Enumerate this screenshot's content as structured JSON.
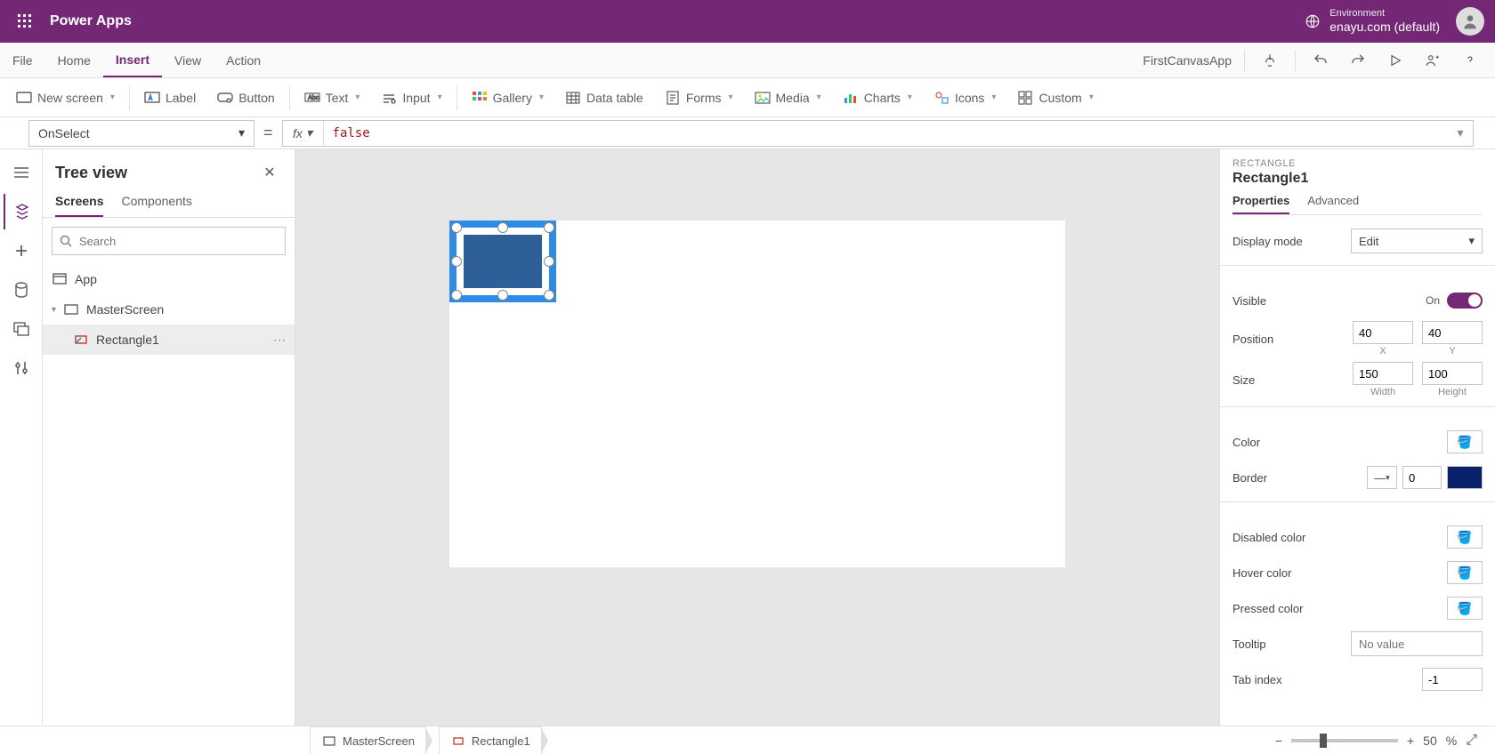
{
  "suite": {
    "app_name": "Power Apps",
    "env_label": "Environment",
    "env_name": "enayu.com (default)"
  },
  "menu": {
    "items": [
      "File",
      "Home",
      "Insert",
      "View",
      "Action"
    ],
    "active": "Insert",
    "app_title": "FirstCanvasApp"
  },
  "ribbon": {
    "new_screen": "New screen",
    "label": "Label",
    "button": "Button",
    "text": "Text",
    "input": "Input",
    "gallery": "Gallery",
    "data_table": "Data table",
    "forms": "Forms",
    "media": "Media",
    "charts": "Charts",
    "icons": "Icons",
    "custom": "Custom"
  },
  "formula": {
    "property": "OnSelect",
    "fx": "fx",
    "value": "false"
  },
  "tree": {
    "title": "Tree view",
    "tabs": {
      "screens": "Screens",
      "components": "Components"
    },
    "search_placeholder": "Search",
    "app": "App",
    "screen": "MasterScreen",
    "shape": "Rectangle1"
  },
  "props": {
    "category": "RECTANGLE",
    "name": "Rectangle1",
    "tabs": {
      "properties": "Properties",
      "advanced": "Advanced"
    },
    "display_mode": {
      "label": "Display mode",
      "value": "Edit"
    },
    "visible": {
      "label": "Visible",
      "state": "On"
    },
    "position": {
      "label": "Position",
      "x": "40",
      "y": "40",
      "xl": "X",
      "yl": "Y"
    },
    "size": {
      "label": "Size",
      "w": "150",
      "h": "100",
      "wl": "Width",
      "hl": "Height"
    },
    "color": {
      "label": "Color"
    },
    "border": {
      "label": "Border",
      "width": "0"
    },
    "disabled": {
      "label": "Disabled color"
    },
    "hover": {
      "label": "Hover color"
    },
    "pressed": {
      "label": "Pressed color"
    },
    "tooltip": {
      "label": "Tooltip",
      "placeholder": "No value"
    },
    "tabindex": {
      "label": "Tab index",
      "value": "-1"
    }
  },
  "status": {
    "crumb_screen": "MasterScreen",
    "crumb_shape": "Rectangle1",
    "zoom": "50",
    "zoom_unit": "%"
  }
}
